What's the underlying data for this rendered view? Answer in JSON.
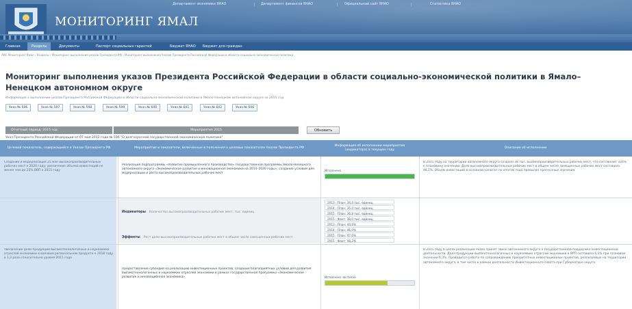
{
  "header": {
    "top_links": [
      "Департамент экономики ЯНАО",
      "Департамент финансов ЯНАО",
      "Официальный сайт ЯНАО",
      "Статистика ЯНАО"
    ],
    "site_title": "МОНИТОРИНГ ЯМАЛ"
  },
  "nav": {
    "items": [
      "Главная",
      "Разделы",
      "Документы",
      "Паспорт социальных гарантий",
      "Бюджет ЯНАО",
      "Бюджет для граждан"
    ],
    "active_index": 1
  },
  "breadcrumb": "АИС Мониторинг Ямал › Разделы › Мониторинг выполнения указов Президента РФ › Мониторинг выполнения Указов Президента Российской Федерации в области социально-экономической политики",
  "page": {
    "title": "Мониторинг выполнения указов Президента Российской Федерации в области социально-экономической политики в Ямало–Ненецком автономном округе",
    "subtitle": "Информация о выполнении указов Президента Российской Федерации в области социально-экономической политики в Ямало-Ненецком автономном округе за 2015 год"
  },
  "decrees": [
    "Указ № 596",
    "Указ № 597",
    "Указ № 598",
    "Указ № 599",
    "Указ № 600",
    "Указ № 601",
    "Указ № 602",
    "Указ № 606"
  ],
  "filters": {
    "period": "Отчетный период: 2015 год",
    "indicator": "Мероприятия 2015",
    "refresh_label": "Обновить"
  },
  "filter_note": "Указ Президента Российской Федерации от 07 мая 2012 года № 596 \"О долгосрочной государственной экономической политике\"",
  "table": {
    "headers": [
      "Целевой показатель, содержащийся в Указах Президента РФ",
      "Мероприятия и показатели, включенные в положения о целевых показателях Указов Президента РФ",
      "Информация об исполнении мероприятия (индикатора) в текущем году",
      "Описание об исполнении"
    ],
    "rows": [
      {
        "indicator": "Создание и модернизация 25 млн высокопроизводительных рабочих мест к 2020 году; увеличение объема инвестиций не менее чем до 25% ВВП к 2015 году",
        "measure": "Реализация подпрограммы «Развитие промышленного производства» государственной программы Ямало-Ненецкого автономного округа «Экономическое развитие и инновационная экономика на 2014–2020 годы»; создание условий для модернизации и роста высокопроизводительных рабочих мест",
        "progress_caption": "Исполнено",
        "progress_value": 100,
        "progress_color": "#49b848",
        "description": "В 2015 году на территории автономного округа создано 38 тыс. высокопроизводительных рабочих мест, что составляет 104% к плановому значению. Доля высокопроизводительных рабочих мест в общем числе замещенных рабочих мест составила 48,2%. Объем инвестиций в основной капитал по итогам года превысил прогнозные значения."
      },
      {
        "indicators_label": "Индикаторы",
        "indicators_text": "Количество высокопроизводительных рабочих мест, тыс. единиц",
        "values": [
          "2013 - План: 34,0 тыс. единиц",
          "2014 - План: 35,4 тыс. единиц",
          "2015 - План: 36,8 тыс. единиц",
          "2015 - Факт: 38,0 тыс. единиц",
          "2013 - План: 44,6%",
          "2014 - План: 46,0%",
          "2015 - План: 47,0%",
          "2015 - Факт: 48,2%"
        ],
        "effects_label": "Эффекты",
        "effects_text": "Рост доли высокопроизводительных рабочих мест в общем числе замещенных рабочих мест"
      },
      {
        "indicator": "Увеличение доли продукции высокотехнологичных и наукоемких отраслей экономики в валовом региональном продукте к 2018 году в 1,3 раза относительно уровня 2011 года",
        "measure": "Предоставление субсидий на реализацию инвестиционных проектов; создание благоприятных условий для развития высокотехнологичных и наукоемких отраслей экономики в рамках государственной программы «Экономическое развитие и инновационная экономика»",
        "progress_caption": "Исполнено частично",
        "progress_value": 70,
        "progress_color": "#b5c92a",
        "description": "В 2015 году в целях реализации Указа принят закон автономного округа о государственной поддержке инвестиционной деятельности. Доля продукции высокотехнологичных и наукоемких отраслей экономики в ВРП составила 6,1% при плановом значении 6,3%. Проводится работа по сопровождению приоритетных инвестиционных проектов, реализуемых на территории автономного округа, в том числе в рамках деятельности Инвестиционного совета при Губернаторе округа."
      }
    ]
  },
  "colors": {
    "header_bg": "#4a77a8",
    "nav_bg": "#2f5f95",
    "nav_active": "#6e9ac8",
    "table_header": "#6f9ac8",
    "indicator_col": "#d4e3f3",
    "progress_done": "#49b848",
    "progress_partial": "#b5c92a"
  },
  "icons": {
    "emblem": "coat-of-arms-icon"
  }
}
